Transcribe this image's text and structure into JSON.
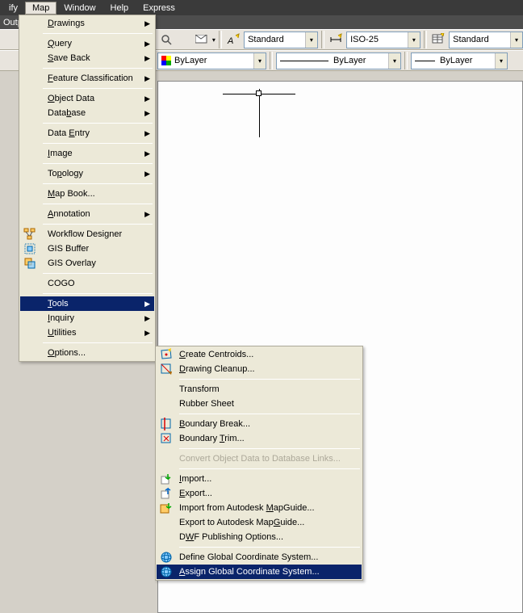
{
  "menubar": {
    "items": [
      "ify",
      "Map",
      "Window",
      "Help",
      "Express"
    ]
  },
  "secondrow": "Outp",
  "toolbar1": {
    "combo1": "Standard",
    "combo2": "ISO-25",
    "combo3": "Standard"
  },
  "toolbar2": {
    "combo1": "ByLayer",
    "combo2": "ByLayer",
    "combo3": "ByLayer"
  },
  "mapMenu": [
    {
      "type": "item",
      "label": "Drawings",
      "u": "D",
      "arrow": true
    },
    {
      "type": "sep"
    },
    {
      "type": "item",
      "label": "Query",
      "u": "Q",
      "arrow": true
    },
    {
      "type": "item",
      "label": "Save Back",
      "u": "S",
      "arrow": true
    },
    {
      "type": "sep"
    },
    {
      "type": "item",
      "label": "Feature Classification",
      "u": "F",
      "arrow": true
    },
    {
      "type": "sep"
    },
    {
      "type": "item",
      "label": "Object Data",
      "u": "O",
      "arrow": true
    },
    {
      "type": "item",
      "label": "Database",
      "u": "b",
      "arrow": true
    },
    {
      "type": "sep"
    },
    {
      "type": "item",
      "label": "Data Entry",
      "u": "E",
      "arrow": true
    },
    {
      "type": "sep"
    },
    {
      "type": "item",
      "label": "Image",
      "u": "I",
      "arrow": true
    },
    {
      "type": "sep"
    },
    {
      "type": "item",
      "label": "Topology",
      "u": "p",
      "arrow": true
    },
    {
      "type": "sep"
    },
    {
      "type": "item",
      "label": "Map Book...",
      "u": "M",
      "arrow": false
    },
    {
      "type": "sep"
    },
    {
      "type": "item",
      "label": "Annotation",
      "u": "A",
      "arrow": true
    },
    {
      "type": "sep"
    },
    {
      "type": "item",
      "icon": "workflow",
      "label": "Workflow Designer",
      "u": "",
      "arrow": false
    },
    {
      "type": "item",
      "icon": "buffer",
      "label": "GIS Buffer",
      "u": "",
      "arrow": false
    },
    {
      "type": "item",
      "icon": "overlay",
      "label": "GIS Overlay",
      "u": "",
      "arrow": false
    },
    {
      "type": "sep"
    },
    {
      "type": "item",
      "label": "COGO",
      "u": "",
      "arrow": false
    },
    {
      "type": "sep"
    },
    {
      "type": "item",
      "label": "Tools",
      "u": "T",
      "arrow": true,
      "hl": true
    },
    {
      "type": "item",
      "label": "Inquiry",
      "u": "I",
      "arrow": true
    },
    {
      "type": "item",
      "label": "Utilities",
      "u": "U",
      "arrow": true
    },
    {
      "type": "sep"
    },
    {
      "type": "item",
      "label": "Options...",
      "u": "O",
      "arrow": false
    }
  ],
  "toolsMenu": [
    {
      "type": "item",
      "icon": "centroids",
      "label": "Create Centroids...",
      "u": "C"
    },
    {
      "type": "item",
      "icon": "cleanup",
      "label": "Drawing Cleanup...",
      "u": "D"
    },
    {
      "type": "sep"
    },
    {
      "type": "item",
      "label": "Transform",
      "u": ""
    },
    {
      "type": "item",
      "label": "Rubber Sheet",
      "u": ""
    },
    {
      "type": "sep"
    },
    {
      "type": "item",
      "icon": "bbreak",
      "label": "Boundary Break...",
      "u": "B"
    },
    {
      "type": "item",
      "icon": "btrim",
      "label": "Boundary Trim...",
      "u": "T"
    },
    {
      "type": "sep"
    },
    {
      "type": "item",
      "label": "Convert Object Data to Database Links...",
      "disabled": true
    },
    {
      "type": "sep"
    },
    {
      "type": "item",
      "icon": "import",
      "label": "Import...",
      "u": "I"
    },
    {
      "type": "item",
      "icon": "export",
      "label": "Export...",
      "u": "E"
    },
    {
      "type": "item",
      "icon": "mgimport",
      "label": "Import from Autodesk MapGuide...",
      "u": "M"
    },
    {
      "type": "item",
      "label": "Export to Autodesk MapGuide...",
      "u": "G"
    },
    {
      "type": "item",
      "label": "DWF Publishing Options...",
      "u": "W"
    },
    {
      "type": "sep"
    },
    {
      "type": "item",
      "icon": "globe",
      "label": "Define Global Coordinate System...",
      "u": ""
    },
    {
      "type": "item",
      "icon": "globe",
      "label": "Assign Global Coordinate System...",
      "u": "A",
      "hl": true
    }
  ]
}
